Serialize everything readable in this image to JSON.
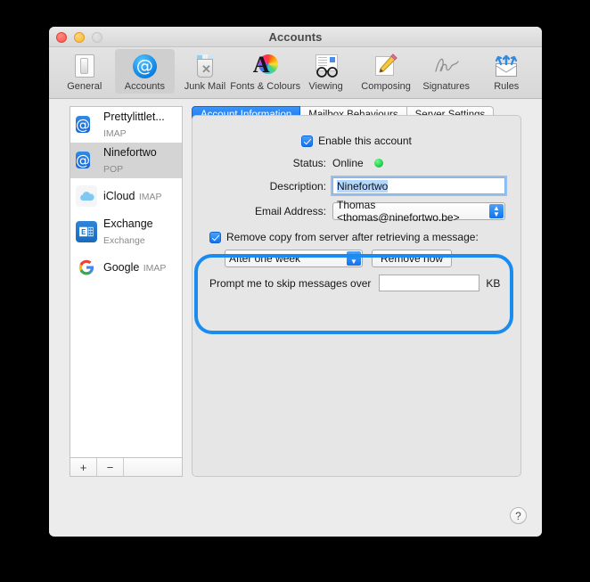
{
  "window": {
    "title": "Accounts",
    "traffic_lights": [
      "close-button",
      "minimize-button",
      "zoom-button"
    ]
  },
  "toolbar": {
    "items": [
      {
        "label": "General",
        "icon": "general-icon"
      },
      {
        "label": "Accounts",
        "icon": "accounts-at-icon"
      },
      {
        "label": "Junk Mail",
        "icon": "junk-mail-icon"
      },
      {
        "label": "Fonts & Colours",
        "icon": "fonts-colours-icon"
      },
      {
        "label": "Viewing",
        "icon": "viewing-glasses-icon"
      },
      {
        "label": "Composing",
        "icon": "composing-pencil-icon"
      },
      {
        "label": "Signatures",
        "icon": "signatures-icon"
      },
      {
        "label": "Rules",
        "icon": "rules-envelope-icon"
      }
    ],
    "selected": "Accounts"
  },
  "sidebar": {
    "accounts": [
      {
        "name": "Prettylittlet...",
        "type": "IMAP",
        "icon": "at-mail-icon"
      },
      {
        "name": "Ninefortwo",
        "type": "POP",
        "icon": "at-mail-icon"
      },
      {
        "name": "iCloud",
        "type": "IMAP",
        "icon": "icloud-icon"
      },
      {
        "name": "Exchange",
        "type": "Exchange",
        "icon": "exchange-icon"
      },
      {
        "name": "Google",
        "type": "IMAP",
        "icon": "google-icon"
      }
    ],
    "selected_index": 1,
    "footer": {
      "add_label": "+",
      "remove_label": "−",
      "actions_label": ""
    }
  },
  "tabs": [
    {
      "label": "Account Information",
      "active": true
    },
    {
      "label": "Mailbox Behaviours",
      "active": false
    },
    {
      "label": "Server Settings",
      "active": false
    }
  ],
  "account_information": {
    "enable_account_label": "Enable this account",
    "enable_account_checked": true,
    "status_label": "Status:",
    "status_value": "Online",
    "status_color": "#19c93f",
    "description_label": "Description:",
    "description_value": "Ninefortwo",
    "email_label": "Email Address:",
    "email_value": "Thomas <thomas@ninefortwo.be>",
    "remove_copy_label": "Remove copy from server after retrieving a message:",
    "remove_copy_checked": true,
    "remove_when_value": "After one week",
    "remove_now_label": "Remove now",
    "prompt_skip_label": "Prompt me to skip messages over",
    "prompt_skip_value": "",
    "prompt_skip_unit": "KB",
    "highlight_color": "#1a8cf0"
  },
  "help_button_label": "?"
}
